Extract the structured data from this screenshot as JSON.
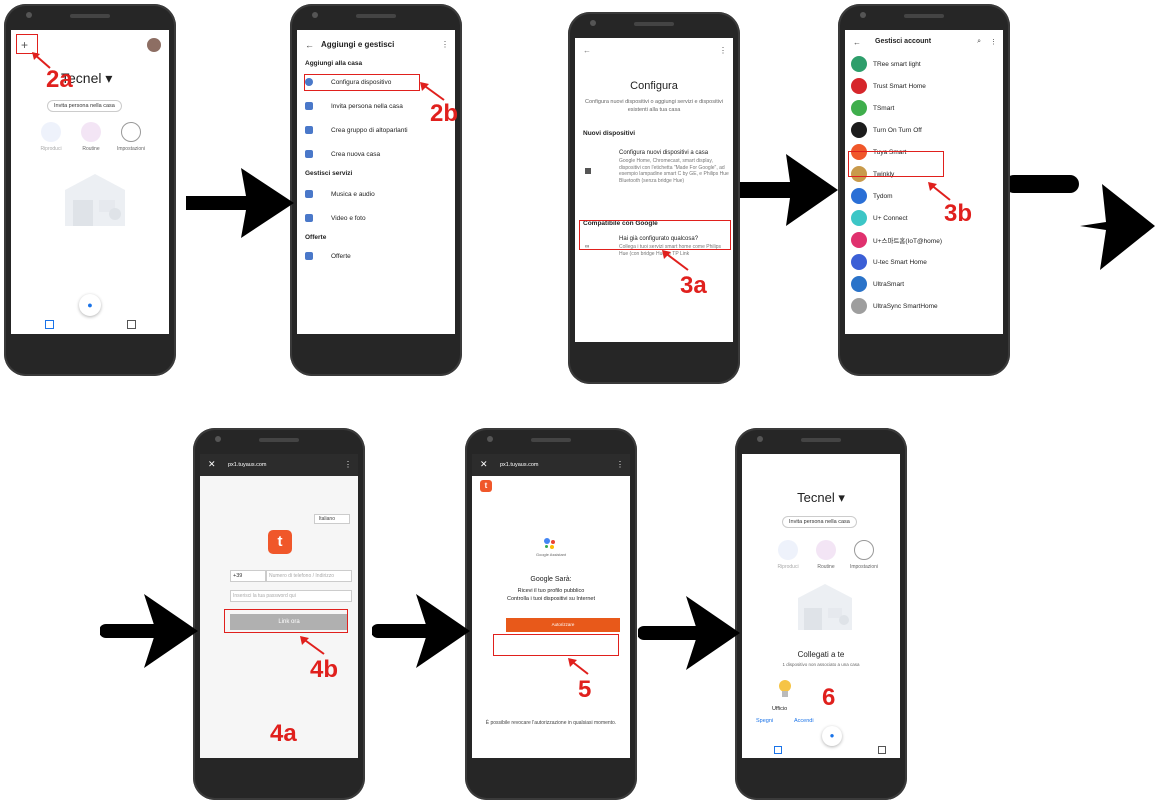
{
  "steps": {
    "s2a": "2a",
    "s2b": "2b",
    "s3a": "3a",
    "s3b": "3b",
    "s4a": "4a",
    "s4b": "4b",
    "s5": "5",
    "s6": "6"
  },
  "phone1": {
    "home_title": "Tecnel ▾",
    "chip": "Invita persona nella casa",
    "actions": [
      "Riproduci",
      "Routine",
      "Impostazioni"
    ]
  },
  "phone2": {
    "title": "Aggiungi e gestisci",
    "sec1": "Aggiungi alla casa",
    "items1": [
      "Configura dispositivo",
      "Invita persona nella casa",
      "Crea gruppo di altoparlanti",
      "Crea nuova casa"
    ],
    "sec2": "Gestisci servizi",
    "items2": [
      "Musica e audio",
      "Video e foto"
    ],
    "sec3": "Offerte",
    "items3": [
      "Offerte"
    ]
  },
  "phone3": {
    "title": "Configura",
    "subtitle": "Configura nuovi dispositivi o aggiungi servizi e dispositivi esistenti alla tua casa",
    "sec1": "Nuovi dispositivi",
    "new_title": "Configura nuovi dispositivi a casa",
    "new_desc": "Google Home, Chromecast, smart display, dispositivi con l'etichetta \"Made For Google\", ad esempio lampadine smart C by GE, e Philips Hue Bluetooth (senza bridge Hue)",
    "sec2": "Compatibile con Google",
    "compat_title": "Hai già configurato qualcosa?",
    "compat_desc": "Collega i tuoi servizi smart home come Philips Hue (con bridge Hue) e TP Link"
  },
  "phone4": {
    "title": "Gestisci account",
    "accounts": [
      "TRee smart light",
      "Trust Smart Home",
      "TSmart",
      "Turn On Turn Off",
      "Tuya Smart",
      "Twinkly",
      "Tydom",
      "U+ Connect",
      "U+스마트홈(IoT@home)",
      "U-tec Smart Home",
      "UltraSmart",
      "UltraSync SmartHome"
    ]
  },
  "phone5": {
    "url": "px1.tuyaus.com",
    "lang": "Italiano",
    "code": "+39",
    "phone_ph": "Numero di telefono / Indirizzo",
    "pass_ph": "Inserisci la tua password qui",
    "button": "Link ora"
  },
  "phone6": {
    "url": "px1.tuyaus.com",
    "ga_label": "Google Assistant",
    "heading": "Google Sarà:",
    "line1": "Ricevi il tuo profilo pubblico",
    "line2": "Controlla i tuoi dispositivi su Internet",
    "button": "Autorizzare",
    "footer": "È possibile revocare l'autorizzazione in qualsiasi momento."
  },
  "phone7": {
    "home_title": "Tecnel ▾",
    "chip": "Invita persona nella casa",
    "actions": [
      "Riproduci",
      "Routine",
      "Impostazioni"
    ],
    "linked_title": "Collegati a te",
    "linked_sub": "1 dispositivo non associato a una casa",
    "device": "Ufficio",
    "off": "Spegni",
    "on": "Accendi"
  },
  "colors": {
    "accent": "#e0201d",
    "tuya": "#f0572a",
    "google_blue": "#1a73e8"
  }
}
